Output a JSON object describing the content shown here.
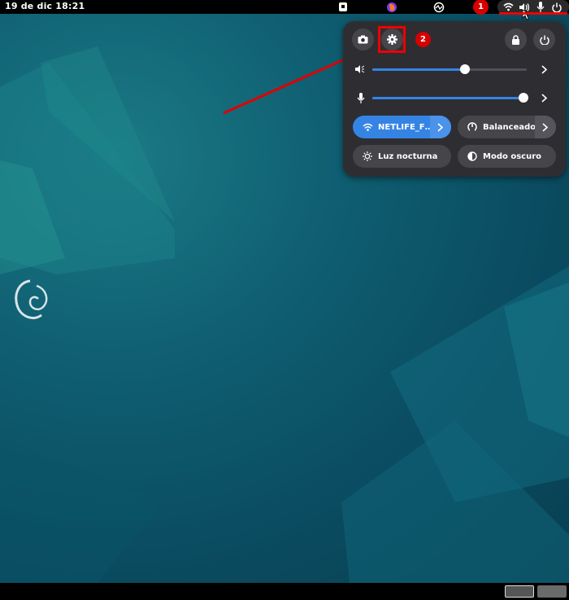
{
  "topbar": {
    "clock": "19 de dic  18:21",
    "apps": [
      "flatpak-icon",
      "firefox-icon",
      "activity-icon"
    ],
    "badge1": "1"
  },
  "quick_settings": {
    "badge2": "2",
    "volume": {
      "level": 0.6
    },
    "microphone": {
      "level": 1.0
    },
    "wifi_toggle": {
      "label": "NETLIFE_F…",
      "active": true
    },
    "power_mode": {
      "label": "Balanceado"
    },
    "night_light": {
      "label": "Luz nocturna"
    },
    "dark_mode": {
      "label": "Modo oscuro"
    }
  },
  "colors": {
    "accent": "#3584e4",
    "annotation": "#e00000",
    "panel": "#2e2e32"
  }
}
